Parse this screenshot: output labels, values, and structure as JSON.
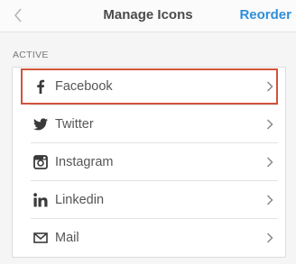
{
  "header": {
    "title": "Manage Icons",
    "reorder_label": "Reorder",
    "back_icon": "chevron-left-icon"
  },
  "section": {
    "label": "ACTIVE"
  },
  "items": [
    {
      "label": "Facebook",
      "icon": "facebook-icon",
      "selected": true
    },
    {
      "label": "Twitter",
      "icon": "twitter-icon"
    },
    {
      "label": "Instagram",
      "icon": "instagram-icon"
    },
    {
      "label": "Linkedin",
      "icon": "linkedin-icon"
    },
    {
      "label": "Mail",
      "icon": "mail-icon"
    }
  ],
  "colors": {
    "accent": "#2c8fdb",
    "highlight": "#d2533b",
    "text": "#555555",
    "icon": "#3a3a3a"
  }
}
